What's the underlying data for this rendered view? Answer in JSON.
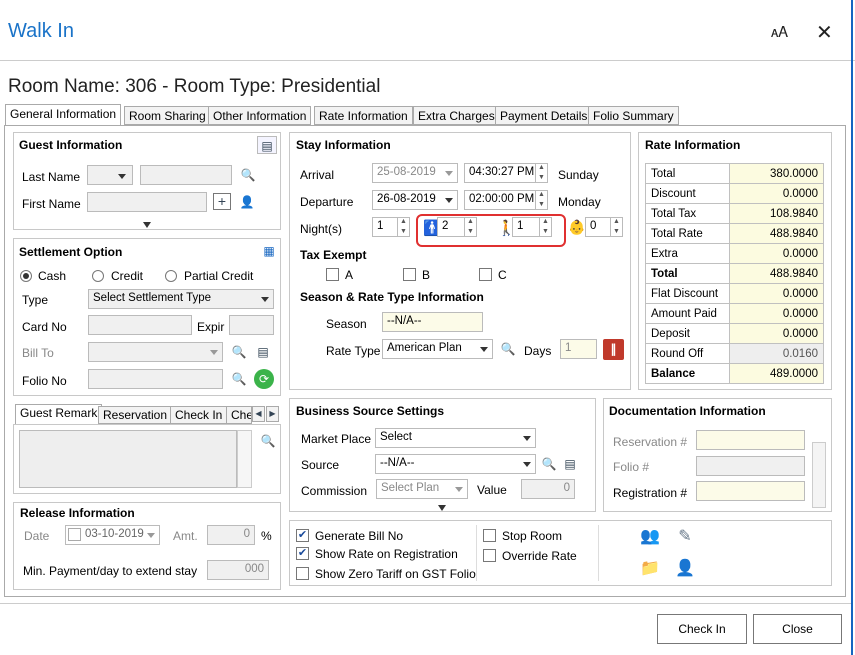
{
  "window": {
    "title": "Walk In",
    "translate_icon": "translate-icon",
    "close_icon": "close-icon"
  },
  "room_header": "Room Name: 306 - Room Type: Presidential",
  "tabs": [
    "General Information",
    "Room Sharing",
    "Other Information",
    "Rate Information",
    "Extra Charges",
    "Payment Details",
    "Folio Summary"
  ],
  "guest": {
    "title": "Guest Information",
    "last_name_label": "Last Name",
    "first_name_label": "First Name",
    "salutation": "",
    "last_name": "",
    "first_name": ""
  },
  "settlement": {
    "title": "Settlement Option",
    "options": [
      "Cash",
      "Credit",
      "Partial Credit"
    ],
    "selected": "Cash",
    "type_label": "Type",
    "type_value": "Select Settlement Type",
    "card_no_label": "Card No",
    "expir_label": "Expir",
    "bill_to_label": "Bill To",
    "folio_no_label": "Folio No"
  },
  "remark_tabs": [
    "Guest Remark",
    "Reservation",
    "Check In",
    "Che"
  ],
  "release": {
    "title": "Release Information",
    "date_label": "Date",
    "date_value": "03-10-2019",
    "amt_label": "Amt.",
    "amt_value": "0",
    "pct": "%",
    "min_payment_label": "Min. Payment/day to extend stay",
    "min_payment_value": "000"
  },
  "stay": {
    "title": "Stay Information",
    "arrival_label": "Arrival",
    "arrival_date": "25-08-2019",
    "arrival_time": "04:30:27 PM",
    "arrival_day": "Sunday",
    "departure_label": "Departure",
    "departure_date": "26-08-2019",
    "departure_time": "02:00:00 PM",
    "departure_day": "Monday",
    "nights_label": "Night(s)",
    "nights": "1",
    "adults": "2",
    "children": "1",
    "infants": "0",
    "tax_exempt_title": "Tax Exempt",
    "tax_options": [
      "A",
      "B",
      "C"
    ],
    "season_title": "Season & Rate Type Information",
    "season_label": "Season",
    "season_value": "--N/A--",
    "rate_type_label": "Rate Type",
    "rate_type_value": "American Plan",
    "days_label": "Days",
    "days_value": "1"
  },
  "rate_info": {
    "title": "Rate Information",
    "rows": [
      {
        "label": "Total",
        "value": "380.0000",
        "bold": false
      },
      {
        "label": "Discount",
        "value": "0.0000",
        "bold": false
      },
      {
        "label": "Total Tax",
        "value": "108.9840",
        "bold": false
      },
      {
        "label": "Total Rate",
        "value": "488.9840",
        "bold": false
      },
      {
        "label": "Extra",
        "value": "0.0000",
        "bold": false
      },
      {
        "label": "Total",
        "value": "488.9840",
        "bold": true
      },
      {
        "label": "Flat Discount",
        "value": "0.0000",
        "bold": false
      },
      {
        "label": "Amount Paid",
        "value": "0.0000",
        "bold": false
      },
      {
        "label": "Deposit",
        "value": "0.0000",
        "bold": false
      },
      {
        "label": "Round Off",
        "value": "0.0160",
        "bold": false
      },
      {
        "label": "Balance",
        "value": "489.0000",
        "bold": true
      }
    ]
  },
  "business": {
    "title": "Business Source Settings",
    "market_label": "Market Place",
    "market_value": "Select",
    "source_label": "Source",
    "source_value": "--N/A--",
    "commission_label": "Commission",
    "commission_value": "Select Plan",
    "value_label": "Value",
    "value_value": "0"
  },
  "documentation": {
    "title": "Documentation Information",
    "reservation_label": "Reservation #",
    "folio_label": "Folio #",
    "registration_label": "Registration #"
  },
  "options": {
    "generate_bill": "Generate Bill No",
    "show_rate": "Show Rate on Registration",
    "show_zero": "Show Zero Tariff on GST Folio",
    "stop_room": "Stop Room",
    "override_rate": "Override Rate"
  },
  "footer": {
    "check_in": "Check In",
    "close": "Close"
  }
}
